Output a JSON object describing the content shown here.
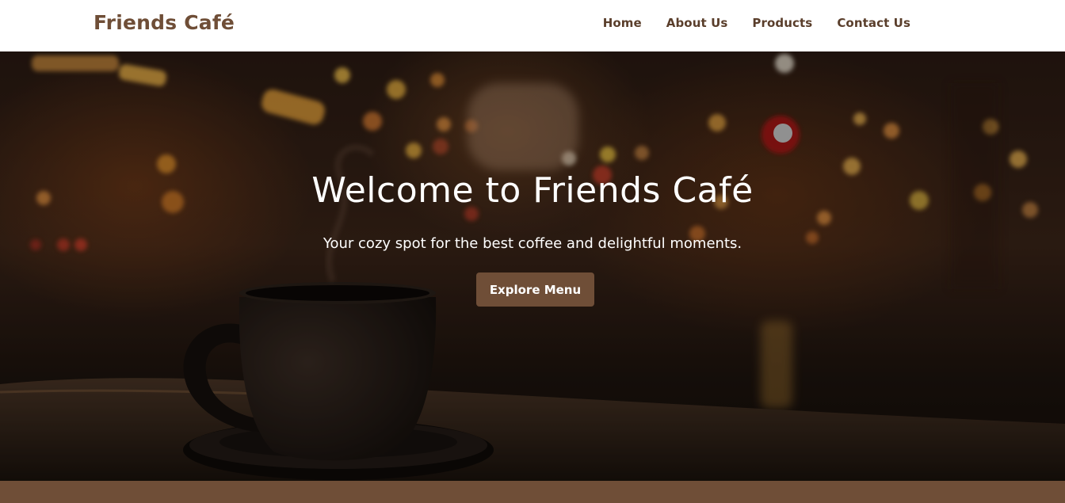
{
  "navbar": {
    "brand": "Friends Café",
    "links": [
      "Home",
      "About Us",
      "Products",
      "Contact Us"
    ]
  },
  "hero": {
    "title": "Welcome to Friends Café",
    "subtitle": "Your cozy spot for the best coffee and delightful moments.",
    "button_label": "Explore Menu"
  },
  "colors": {
    "brand": "#6f4e37",
    "nav_text": "#5a3e2b",
    "button_bg": "#6f4e37",
    "hero_text": "#ffffff"
  }
}
